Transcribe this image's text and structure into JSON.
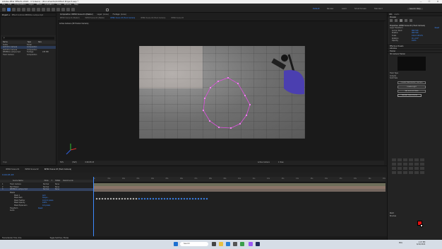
{
  "window": {
    "title": "Adobe After Effects 2024 - C:\\Users\\...\\Documents\\Untitled Project.aep *",
    "controls": [
      "—",
      "☐",
      "✕"
    ]
  },
  "menu": [
    "File",
    "Edit",
    "Composition",
    "Layer",
    "Effect",
    "Animation",
    "View",
    "Window",
    "Help"
  ],
  "workspaces": {
    "items": [
      "Default",
      "Review",
      "Learn",
      "Small Screen",
      "Standard"
    ],
    "active": "Default",
    "search": "Search Help"
  },
  "left_panel": {
    "tabs": [
      "Project ≡",
      "Effect Controls REDBULL Lamps.mp4"
    ],
    "search_placeholder": "ρ",
    "columns": [
      "Name",
      "Type",
      "Size"
    ],
    "items": [
      {
        "name": "Solids",
        "type": "Folder",
        "size": ""
      },
      {
        "name": "ACTIVE 1 Camera",
        "type": "Composition",
        "size": ""
      },
      {
        "name": "ACTIVE 2 Camera",
        "type": "Composition",
        "size": ""
      },
      {
        "name": "REDBULL Lamps.mp4",
        "type": "Footage",
        "size": "245 MB"
      },
      {
        "name": "Track Camera",
        "type": "Composition",
        "size": ""
      }
    ],
    "footer": "8 bpc"
  },
  "viewer": {
    "tabs": [
      "Composition: INTRO Scene 01 (Master)",
      "Layer: (none)",
      "Footage: (none)"
    ],
    "subtabs": [
      "INTRO Scene 01 (Master)",
      "INTRO Scene 02 (Master)",
      "INTRO Scene 03 (Track Camera)",
      "INTRO Scene 04 (Track Camera)",
      "INTRO Scene 05"
    ],
    "label": "Active Camera (3D Tracker Camera)",
    "zoom": "50%",
    "quality": "(Half)",
    "timecode": "0;00;05;18",
    "camera_label": "Active Camera",
    "view_label": "1 View"
  },
  "timeline": {
    "tabs": [
      "INTRO Scene 01",
      "INTRO Scene 02",
      "INTRO Scene 03 (Track Camera)"
    ],
    "timecode": "0;00;05;18",
    "columns": [
      "Source Name",
      "Mode",
      "T",
      "TrkMat",
      "Parent & Link"
    ],
    "layers": [
      {
        "num": "1",
        "name": "Track Camera",
        "mode": "Normal",
        "parent": "None"
      },
      {
        "num": "2",
        "name": "Null Helper",
        "mode": "Normal",
        "parent": "None"
      },
      {
        "num": "3",
        "name": "REDBULL Lamps.mp4",
        "mode": "Normal",
        "parent": "None"
      }
    ],
    "props": [
      {
        "name": "Masks",
        "value": ""
      },
      {
        "name": "Mask 1",
        "value": "Add"
      },
      {
        "name": "Mask Path",
        "value": "Shape..."
      },
      {
        "name": "Mask Feather",
        "value": "0.0,0.0 pixels"
      },
      {
        "name": "Mask Opacity",
        "value": "100%"
      },
      {
        "name": "Mask Expansion",
        "value": "0.0 pixels"
      },
      {
        "name": "Transform",
        "value": "Reset"
      },
      {
        "name": "Audio",
        "value": ""
      }
    ],
    "ruler": [
      "0s",
      "01s",
      "02s",
      "03s",
      "04s",
      "05s",
      "06s",
      "07s",
      "08s",
      "09s",
      "10s",
      "11s",
      "12s",
      "13s",
      "14s",
      "15s",
      "16s",
      "17s",
      "18s",
      "19s",
      "20s"
    ],
    "footer": "Frame Render Time: 0ms",
    "toggle": "Toggle Switches / Modes"
  },
  "right_panel": {
    "info_tab": "Info",
    "audio_tab": "Audio",
    "preview_tab": "Preview",
    "properties_title": "Properties: INTRO Scene 01 (Track Camera)",
    "layer_transform": "Layer Transform",
    "reset": "Reset",
    "transform_rows": [
      {
        "label": "Anchor Point",
        "value": "960   540"
      },
      {
        "label": "Position",
        "value": "960   540"
      },
      {
        "label": "Scale",
        "value": "100.0  100.0%"
      },
      {
        "label": "Rotation",
        "value": "0x +0.0°"
      },
      {
        "label": "Opacity",
        "value": "100%"
      }
    ],
    "sections": [
      "Effects & Presets",
      "Libraries",
      "Tracker",
      "3D Camera Tracker",
      "Paragraph",
      "Align",
      "Paint"
    ],
    "tracker_buttons": [
      "Create Stabilization Camera",
      "Create Light",
      "Set Ground Plane"
    ],
    "track_type": "Track Type",
    "analyze": "Analyze",
    "solid_label": "Solid Size",
    "render_btn": "Render Track Points",
    "brush_label": "Brushes",
    "color_primary": "#e01010",
    "color_secondary": "#ffffff"
  },
  "taskbar": {
    "search_placeholder": "Search",
    "time": "1:47 PM",
    "date": "6/22/2024",
    "lang": "ENG"
  }
}
